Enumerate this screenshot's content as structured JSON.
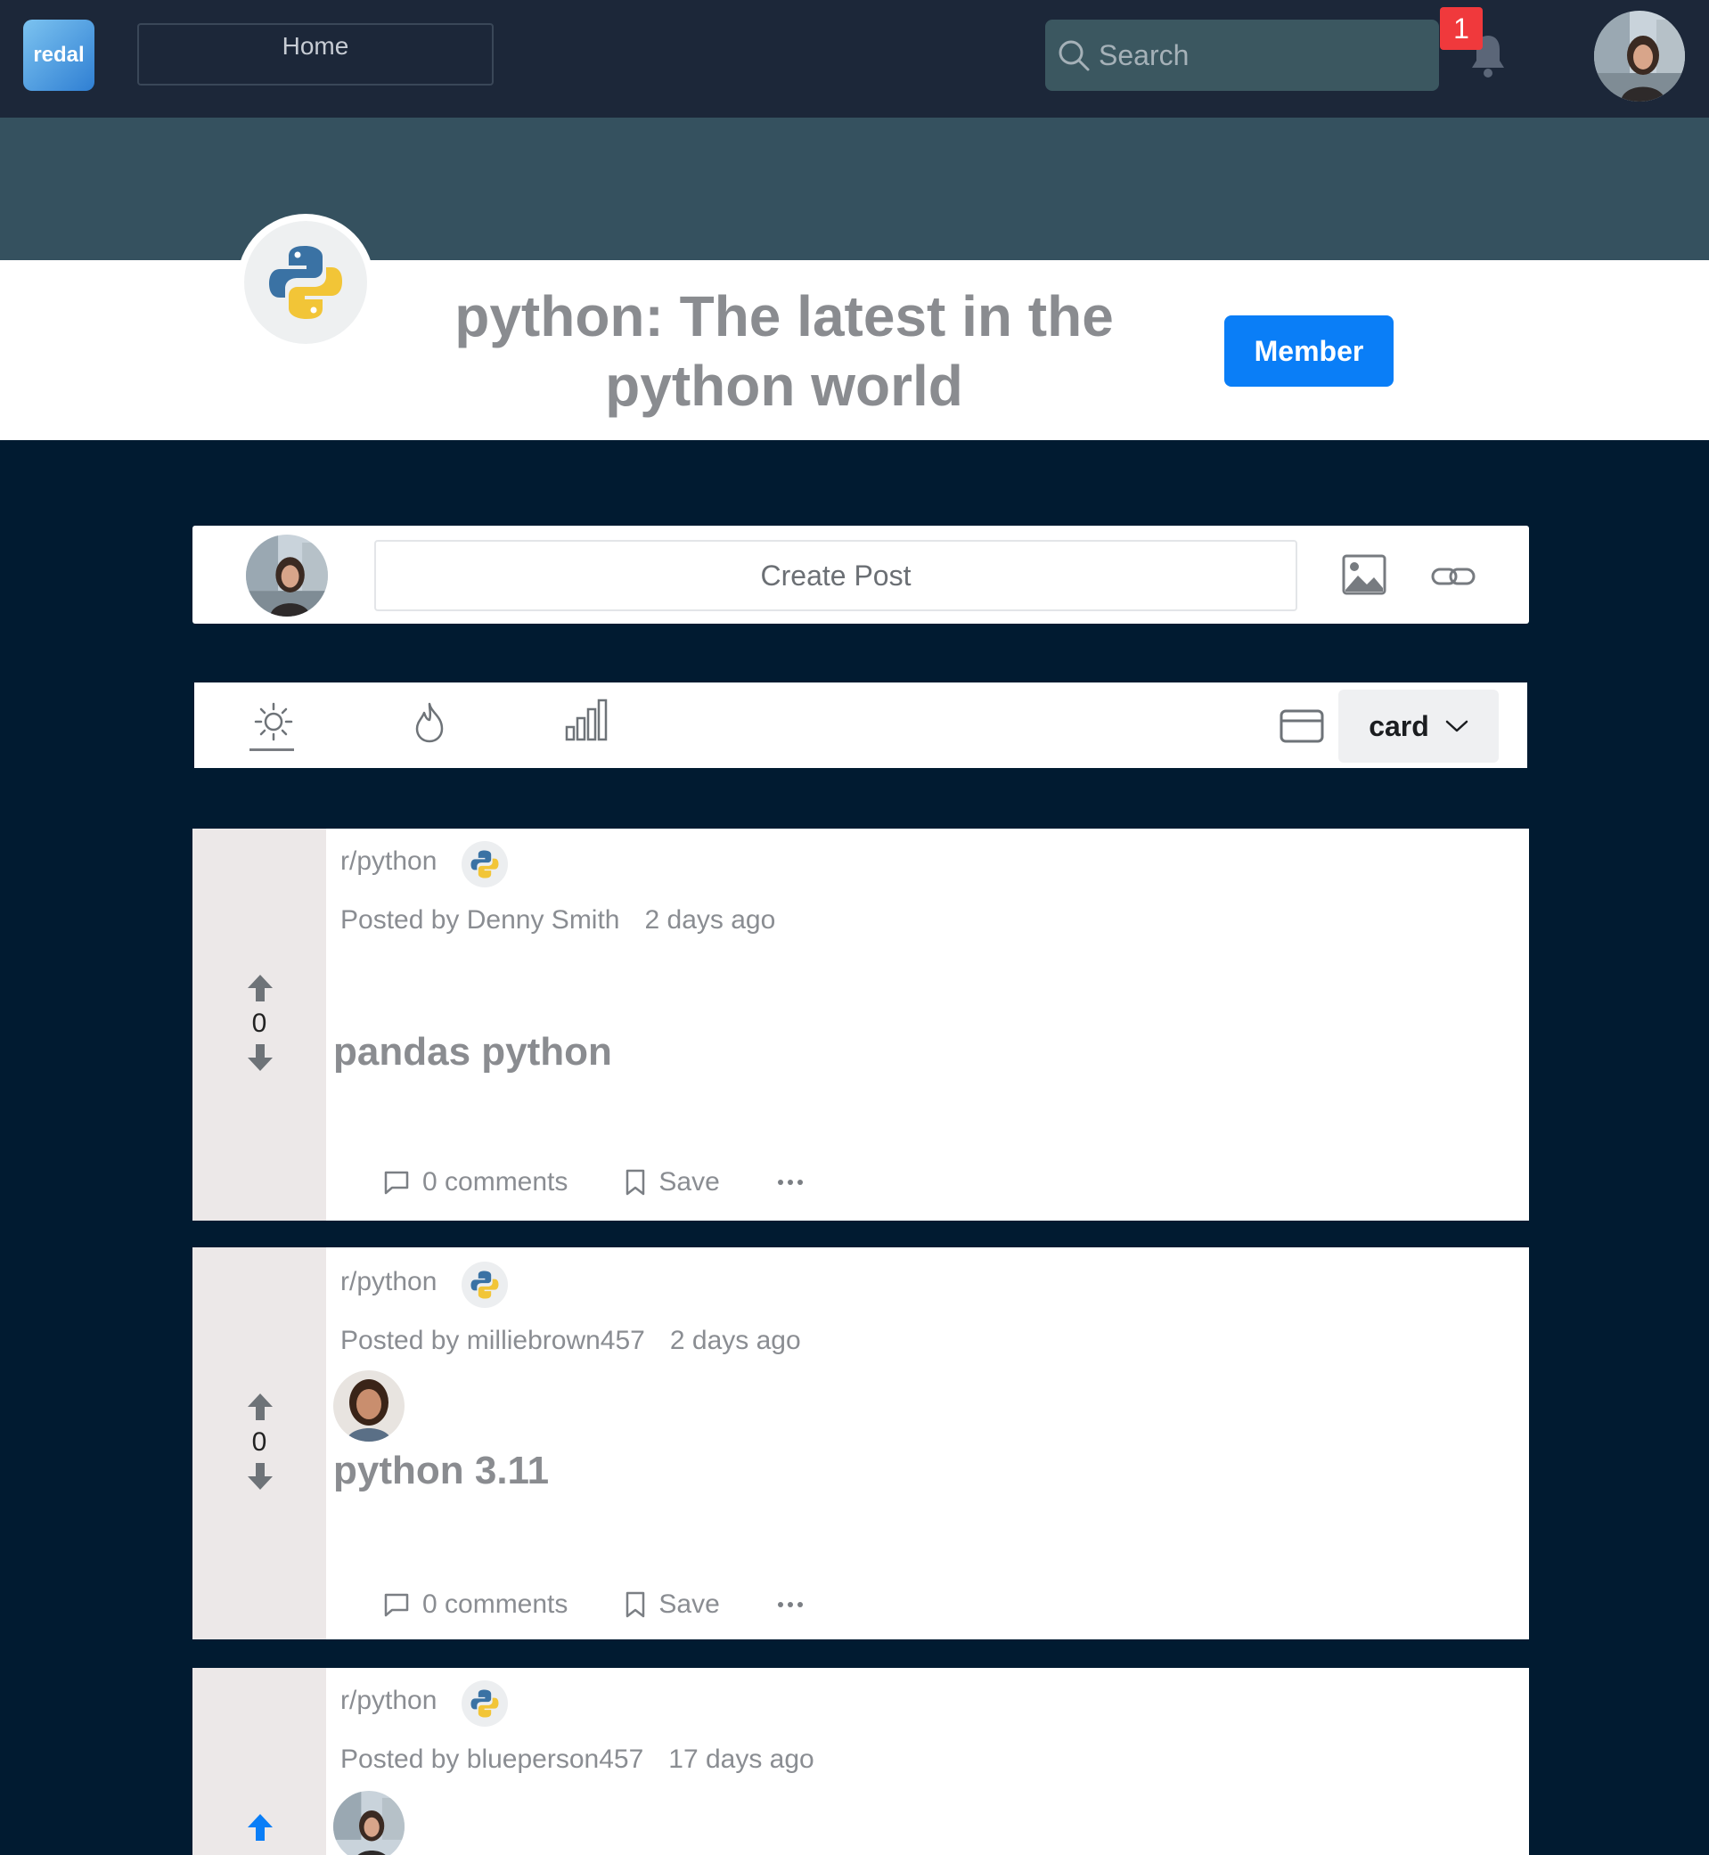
{
  "topbar": {
    "logo_text": "redal",
    "home_label": "Home",
    "search_placeholder": "Search",
    "notification_count": "1"
  },
  "community": {
    "title": "python: The latest in the python world",
    "member_button": "Member"
  },
  "create_post": {
    "placeholder": "Create Post"
  },
  "sort_bar": {
    "view_mode": "card"
  },
  "posts": [
    {
      "subreddit": "r/python",
      "posted_by": "Posted by Denny Smith",
      "time": "2 days ago",
      "title": "pandas python",
      "score": "0",
      "comments": "0 comments",
      "save": "Save"
    },
    {
      "subreddit": "r/python",
      "posted_by": "Posted by milliebrown457",
      "time": "2 days ago",
      "title": "python 3.11",
      "score": "0",
      "comments": "0 comments",
      "save": "Save"
    },
    {
      "subreddit": "r/python",
      "posted_by": "Posted by blueperson457",
      "time": "17 days ago"
    }
  ],
  "colors": {
    "topbar": "#1c2739",
    "banner": "#35515f",
    "page_bg": "#011b31",
    "member_button": "#0a7ef7",
    "badge": "#f0393c",
    "upvote_active": "#0a7ef7"
  }
}
